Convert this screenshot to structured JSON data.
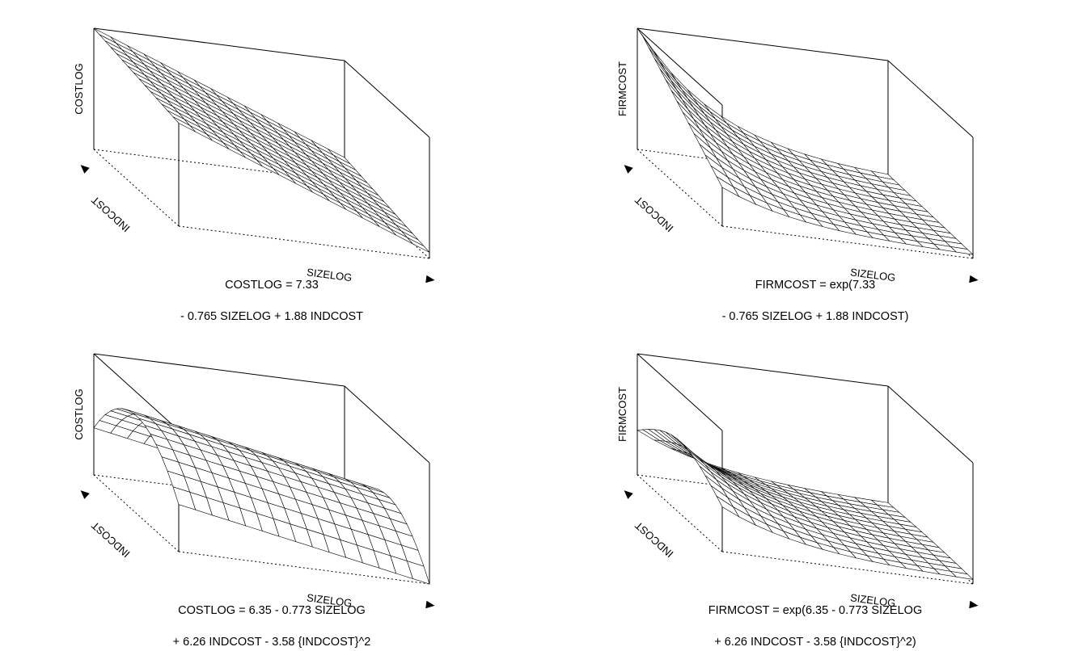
{
  "chart_data": [
    {
      "type": "surface3d",
      "zlabel": "COSTLOG",
      "ylabel_depth": "INDCOST",
      "xlabel": "SIZELOG",
      "equation": "COSTLOG = 7.33 - 0.765 SIZELOG + 1.88 INDCOST",
      "caption_line1": "COSTLOG = 7.33",
      "caption_line2": "- 0.765 SIZELOG + 1.88 INDCOST",
      "grid_n": 15,
      "x_range": [
        0,
        1
      ],
      "y_range": [
        0,
        1
      ],
      "z_fn": "linear_tilt",
      "z_params": {
        "z00": 0.85,
        "z10": 0.05,
        "z01": 1.0,
        "z11": 0.2
      }
    },
    {
      "type": "surface3d",
      "zlabel": "FIRMCOST",
      "ylabel_depth": "INDCOST",
      "xlabel": "SIZELOG",
      "equation": "FIRMCOST = exp(7.33 - 0.765 SIZELOG + 1.88 INDCOST)",
      "caption_line1": "FIRMCOST = exp(7.33",
      "caption_line2": "- 0.765 SIZELOG + 1.88 INDCOST)",
      "grid_n": 15,
      "x_range": [
        0,
        1
      ],
      "y_range": [
        0,
        1
      ],
      "z_fn": "exp_decay_xy",
      "z_params": {
        "scale": 1.0,
        "kx": 3.2,
        "ky_gain": 0.7
      }
    },
    {
      "type": "surface3d",
      "zlabel": "COSTLOG",
      "ylabel_depth": "INDCOST",
      "xlabel": "SIZELOG",
      "equation": "COSTLOG = 6.35 - 0.773 SIZELOG + 6.26 INDCOST - 3.58 {INDCOST}^2",
      "caption_line1": "COSTLOG = 6.35 - 0.773 SIZELOG",
      "caption_line2": "+ 6.26 INDCOST - 3.58 {INDCOST}^2",
      "grid_n": 15,
      "x_range": [
        0,
        1
      ],
      "y_range": [
        0,
        1
      ],
      "z_fn": "quad_y_linear_x",
      "z_params": {
        "a": -3.0,
        "b": 3.0,
        "cx": -0.7,
        "base": 0.55
      }
    },
    {
      "type": "surface3d",
      "zlabel": "FIRMCOST",
      "ylabel_depth": "INDCOST",
      "xlabel": "SIZELOG",
      "equation": "FIRMCOST = exp(6.35 - 0.773 SIZELOG + 6.26 INDCOST - 3.58 {INDCOST}^2)",
      "caption_line1": "FIRMCOST = exp(6.35 - 0.773 SIZELOG",
      "caption_line2": "+ 6.26 INDCOST - 3.58 {INDCOST}^2)",
      "grid_n": 15,
      "x_range": [
        0,
        1
      ],
      "y_range": [
        0,
        1
      ],
      "z_fn": "exp_quad",
      "z_params": {
        "scale": 1.0,
        "kx": 3.0,
        "a": -2.0,
        "b": 2.0
      }
    }
  ]
}
